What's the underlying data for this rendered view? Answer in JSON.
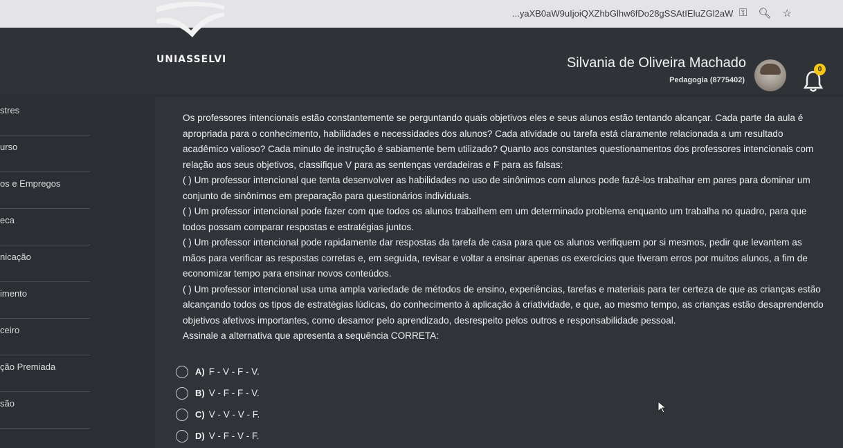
{
  "browser": {
    "url": "...yaXB0aW9uIjoiQXZhbGlhw6fDo28gSSAtIEluZGl2aW...",
    "icons": [
      "key-icon",
      "zoom-icon",
      "star-icon"
    ]
  },
  "header": {
    "logo_text": "UNIASSELVI",
    "user_name": "Silvania de Oliveira Machado",
    "course": "Pedagogia (8775402)",
    "notification_count": "0"
  },
  "sidebar": {
    "items": [
      {
        "label": "stres"
      },
      {
        "label": "urso"
      },
      {
        "label": "os e Empregos"
      },
      {
        "label": "eca"
      },
      {
        "label": "nicação"
      },
      {
        "label": "imento"
      },
      {
        "label": "ceiro"
      },
      {
        "label": "ção Premiada"
      },
      {
        "label": "são"
      }
    ]
  },
  "question": {
    "intro": "Os professores intencionais estão constantemente se perguntando quais objetivos eles e seus alunos estão tentando alcançar. Cada parte da aula é apropriada para o conhecimento, habilidades e necessidades dos alunos? Cada atividade ou tarefa está claramente relacionada a um resultado acadêmico valioso? Cada minuto de instrução é sabiamente bem utilizado? Quanto aos constantes questionamentos dos professores intencionais com relação aos seus objetivos, classifique V para as sentenças verdadeiras e F para as falsas:",
    "statements": [
      "(     ) Um professor intencional que tenta desenvolver as habilidades no uso de sinônimos com alunos pode fazê-los trabalhar em pares para dominar um conjunto de sinônimos em preparação para questionários individuais.",
      "(     ) Um professor intencional pode fazer com que todos os alunos trabalhem em um determinado problema enquanto um trabalha no quadro, para que todos possam comparar respostas e estratégias juntos.",
      "(     ) Um professor intencional pode rapidamente dar respostas da tarefa de casa para que os alunos verifiquem por si mesmos, pedir que levantem as mãos para verificar as respostas corretas e, em seguida, revisar e voltar a ensinar apenas os exercícios que tiveram erros por muitos alunos, a fim de economizar tempo para ensinar novos conteúdos.",
      "(     ) Um professor intencional usa uma ampla variedade de métodos de ensino, experiências, tarefas e materiais para ter certeza de que as crianças estão alcançando todos os tipos de estratégias lúdicas, do conhecimento à aplicação à criatividade, e que, ao mesmo tempo, as crianças estão desaprendendo objetivos afetivos importantes, como desamor pelo aprendizado, desrespeito pelos outros e responsabilidade pessoal."
    ],
    "prompt": "Assinale a alternativa que apresenta a sequência CORRETA:"
  },
  "options": [
    {
      "letter": "A)",
      "text": "F - V - F - V."
    },
    {
      "letter": "B)",
      "text": "V - F - F - V."
    },
    {
      "letter": "C)",
      "text": "V - V - V - F."
    },
    {
      "letter": "D)",
      "text": "V - F - V - F."
    }
  ],
  "colors": {
    "background": "#2b2e33",
    "badge": "#f5c518",
    "text": "#e9eaec"
  }
}
